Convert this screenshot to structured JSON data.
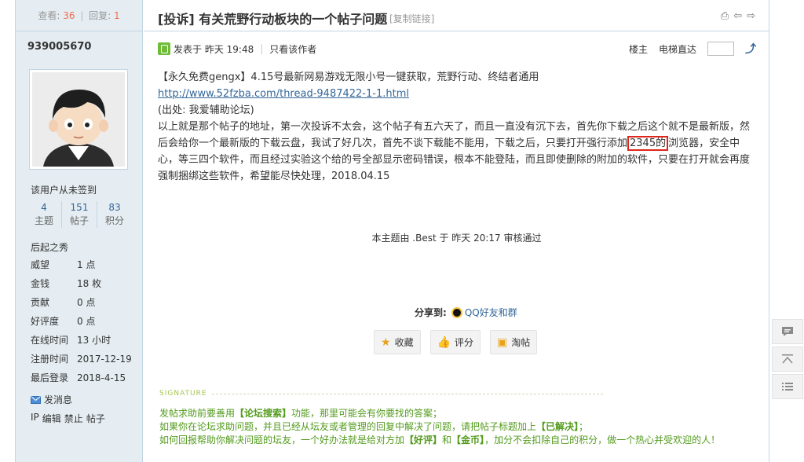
{
  "stats": {
    "view_label": "查看:",
    "view_count": "36",
    "separator": "|",
    "reply_label": "回复:",
    "reply_count": "1"
  },
  "user": {
    "name": "939005670",
    "signin_status": "该用户从未签到",
    "counts": [
      {
        "value": "4",
        "label": "主题"
      },
      {
        "value": "151",
        "label": "帖子"
      },
      {
        "value": "83",
        "label": "积分"
      }
    ],
    "rank": "后起之秀",
    "props": [
      {
        "key": "威望",
        "value": "1 点"
      },
      {
        "key": "金钱",
        "value": "18 枚"
      },
      {
        "key": "贡献",
        "value": "0 点"
      },
      {
        "key": "好评度",
        "value": "0 点"
      },
      {
        "key": "在线时间",
        "value": "13 小时"
      },
      {
        "key": "注册时间",
        "value": "2017-12-19"
      },
      {
        "key": "最后登录",
        "value": "2018-4-15"
      }
    ],
    "send_message": "发消息",
    "admin_links": [
      "IP",
      "编辑",
      "禁止",
      "帖子"
    ]
  },
  "thread": {
    "title": "[投诉] 有关荒野行动板块的一个帖子问题",
    "copy_link": "[复制链接]"
  },
  "post": {
    "posted_at": "发表于 昨天 19:48",
    "only_author": "只看该作者",
    "floor_label": "楼主",
    "jump_label": "电梯直达",
    "lines": {
      "l1": "【永久免费gengx】4.15号最新网易游戏无限小号一键获取，荒野行动、终结者通用",
      "link": "http://www.52fzba.com/thread-9487422-1-1.html",
      "source": "(出处: 我爱辅助论坛)",
      "body_a": "以上就是那个帖子的地址，第一次投诉不太会，这个帖子有五六天了，而且一直没有沉下去，首先你下载之后这个就不是最新版，然后会给你一个最新版的下载云盘，我试了好几次，首先不谈下载能不能用，下载之后，只要打开强行添加",
      "highlight": "2345的",
      "body_b": "浏览器，安全中心，等三四个软件，而且经过实验这个给的号全部显示密码错误，根本不能登陆，而且即使删除的附加的软件，只要在打开就会再度强制捆绑这些软件，希望能尽快处理，2018.04.15"
    },
    "audit": "本主题由 .Best 于 昨天 20:17 审核通过",
    "share_label": "分享到:",
    "share_qq": "QQ好友和群",
    "actions": [
      {
        "label": "收藏",
        "icon": "star-icon"
      },
      {
        "label": "评分",
        "icon": "thumbs-up-icon"
      },
      {
        "label": "淘帖",
        "icon": "tag-icon"
      }
    ],
    "signature_label": "SIGNATURE",
    "signature": {
      "l1a": "发帖求助前要善用",
      "l1b": "【论坛搜索】",
      "l1c": "功能，那里可能会有你要找的答案；",
      "l2a": "如果你在论坛求助问题，并且已经从坛友或者管理的回复中解决了问题，请把帖子标题加上",
      "l2b": "【已解决】",
      "l2c": "；",
      "l3a": "如何回报帮助你解决问题的坛友，一个好办法就是给对方加",
      "l3b": "【好评】",
      "l3c": "和",
      "l3d": "【金币】",
      "l3e": "，加分不会扣除自己的积分，做一个热心并受欢迎的人！"
    }
  },
  "floatbar": [
    "comment-icon",
    "back-to-top-icon",
    "list-icon"
  ]
}
